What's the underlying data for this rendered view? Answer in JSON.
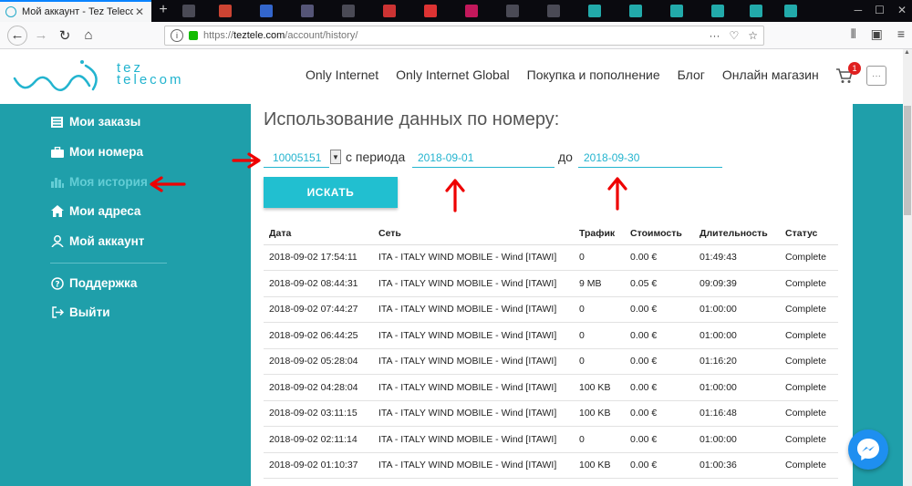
{
  "browser": {
    "tab_title": "Мой аккаунт - Tez Telecom",
    "url_protocol": "https://",
    "url_host": "teztele.com",
    "url_path": "/account/history/"
  },
  "site": {
    "logo_line1": "tez",
    "logo_line2": "telecom",
    "menu": [
      "Only Internet",
      "Only Internet Global",
      "Покупка и пополнение",
      "Блог",
      "Онлайн магазин"
    ],
    "cart_count": "1",
    "accent_color": "#23b4cf",
    "sidebar_color": "#1f9faa"
  },
  "sidebar": {
    "items": [
      {
        "label": "Мои заказы",
        "icon": "list-icon"
      },
      {
        "label": "Мои номера",
        "icon": "briefcase-icon"
      },
      {
        "label": "Моя история",
        "icon": "bar-chart-icon"
      },
      {
        "label": "Мои адреса",
        "icon": "home-icon"
      },
      {
        "label": "Мой аккаунт",
        "icon": "user-icon"
      }
    ],
    "support": "Поддержка",
    "logout": "Выйти"
  },
  "content": {
    "title": "Использование данных по номеру:",
    "number": "10005151",
    "from_label": "с периода",
    "date_from": "2018-09-01",
    "to_label": "до",
    "date_to": "2018-09-30",
    "search_button": "ИСКАТЬ"
  },
  "table": {
    "headers": [
      "Дата",
      "Сеть",
      "Трафик",
      "Стоимость",
      "Длительность",
      "Статус"
    ],
    "rows": [
      [
        "2018-09-02 17:54:11",
        "ITA - ITALY WIND MOBILE - Wind [ITAWI]",
        "0",
        "0.00 €",
        "01:49:43",
        "Complete"
      ],
      [
        "2018-09-02 08:44:31",
        "ITA - ITALY WIND MOBILE - Wind [ITAWI]",
        "9 MB",
        "0.05 €",
        "09:09:39",
        "Complete"
      ],
      [
        "2018-09-02 07:44:27",
        "ITA - ITALY WIND MOBILE - Wind [ITAWI]",
        "0",
        "0.00 €",
        "01:00:00",
        "Complete"
      ],
      [
        "2018-09-02 06:44:25",
        "ITA - ITALY WIND MOBILE - Wind [ITAWI]",
        "0",
        "0.00 €",
        "01:00:00",
        "Complete"
      ],
      [
        "2018-09-02 05:28:04",
        "ITA - ITALY WIND MOBILE - Wind [ITAWI]",
        "0",
        "0.00 €",
        "01:16:20",
        "Complete"
      ],
      [
        "2018-09-02 04:28:04",
        "ITA - ITALY WIND MOBILE - Wind [ITAWI]",
        "100 KB",
        "0.00 €",
        "01:00:00",
        "Complete"
      ],
      [
        "2018-09-02 03:11:15",
        "ITA - ITALY WIND MOBILE - Wind [ITAWI]",
        "100 KB",
        "0.00 €",
        "01:16:48",
        "Complete"
      ],
      [
        "2018-09-02 02:11:14",
        "ITA - ITALY WIND MOBILE - Wind [ITAWI]",
        "0",
        "0.00 €",
        "01:00:00",
        "Complete"
      ],
      [
        "2018-09-02 01:10:37",
        "ITA - ITALY WIND MOBILE - Wind [ITAWI]",
        "100 KB",
        "0.00 €",
        "01:00:36",
        "Complete"
      ]
    ]
  }
}
